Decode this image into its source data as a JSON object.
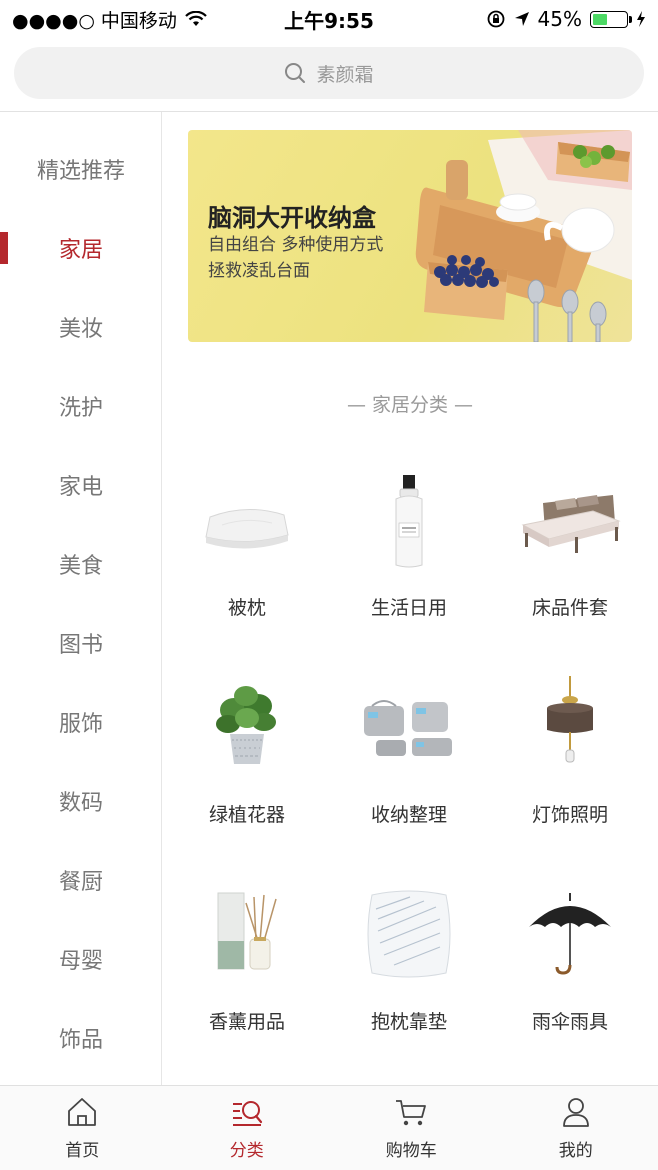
{
  "status_bar": {
    "carrier": "●●●●○ 中国移动",
    "time": "上午9:55",
    "battery_text": "45%",
    "battery_level": 0.45
  },
  "search": {
    "placeholder": "素颜霜"
  },
  "sidebar": {
    "items": [
      {
        "label": "精选推荐"
      },
      {
        "label": "家居"
      },
      {
        "label": "美妆"
      },
      {
        "label": "洗护"
      },
      {
        "label": "家电"
      },
      {
        "label": "美食"
      },
      {
        "label": "图书"
      },
      {
        "label": "服饰"
      },
      {
        "label": "数码"
      },
      {
        "label": "餐厨"
      },
      {
        "label": "母婴"
      },
      {
        "label": "饰品"
      }
    ],
    "active_index": 1
  },
  "banner": {
    "title": "脑洞大开收纳盒",
    "subtitle_1": "自由组合 多种使用方式",
    "subtitle_2": "拯救凌乱台面"
  },
  "section": {
    "title": "— 家居分类 —"
  },
  "categories": [
    {
      "label": "被枕",
      "icon": "pillow-icon"
    },
    {
      "label": "生活日用",
      "icon": "bottle-icon"
    },
    {
      "label": "床品件套",
      "icon": "bed-icon"
    },
    {
      "label": "绿植花器",
      "icon": "plant-icon"
    },
    {
      "label": "收纳整理",
      "icon": "storage-bags-icon"
    },
    {
      "label": "灯饰照明",
      "icon": "lamp-icon"
    },
    {
      "label": "香薰用品",
      "icon": "diffuser-icon"
    },
    {
      "label": "抱枕靠垫",
      "icon": "cushion-icon"
    },
    {
      "label": "雨伞雨具",
      "icon": "umbrella-icon"
    }
  ],
  "tabbar": {
    "tabs": [
      {
        "label": "首页",
        "icon": "home-icon"
      },
      {
        "label": "分类",
        "icon": "category-icon"
      },
      {
        "label": "购物车",
        "icon": "cart-icon"
      },
      {
        "label": "我的",
        "icon": "user-icon"
      }
    ],
    "active_index": 1
  },
  "colors": {
    "accent": "#b4282d",
    "banner_bg": "#f0e487",
    "battery": "#4cd964"
  }
}
